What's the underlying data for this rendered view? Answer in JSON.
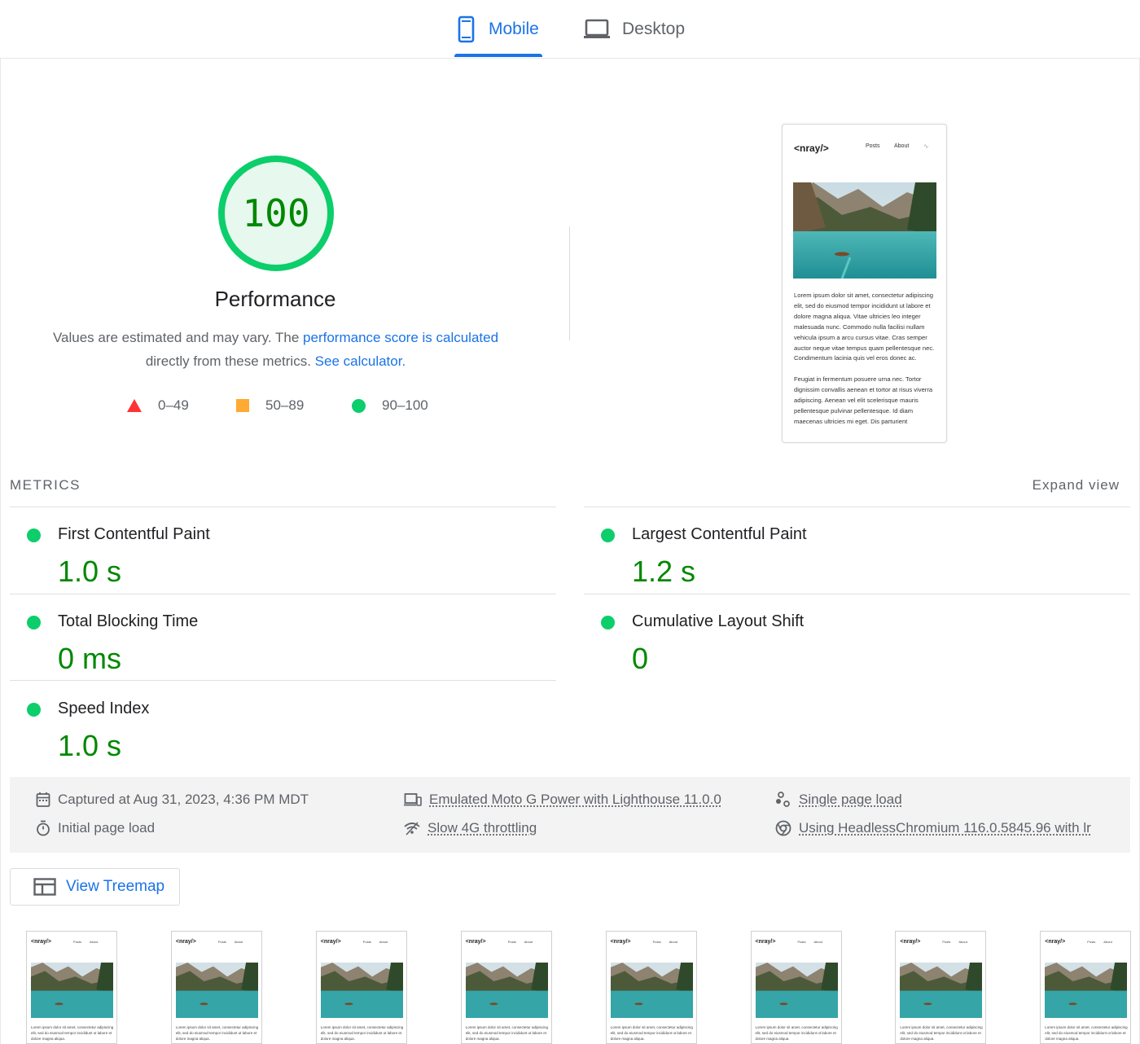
{
  "tabs": {
    "mobile": "Mobile",
    "desktop": "Desktop",
    "active": "Mobile"
  },
  "score": {
    "value": "100",
    "label": "Performance",
    "desc_prefix": "Values are estimated and may vary. The ",
    "desc_link1": "performance score is calculated",
    "desc_middle": " directly from these metrics. ",
    "desc_link2": "See calculator.",
    "color_pass": "#0cce6b",
    "color_text_pass": "#008800"
  },
  "legend": {
    "fail": "0–49",
    "average": "50–89",
    "pass": "90–100",
    "colors": {
      "fail": "#ff3333",
      "average": "#ffaa33",
      "pass": "#0cce6b"
    }
  },
  "screenshot": {
    "logo": "<nray/>",
    "nav_posts": "Posts",
    "nav_about": "About",
    "paragraph1": "Lorem ipsum dolor sit amet, consectetur adipiscing elit, sed do eiusmod tempor incididunt ut labore et dolore magna aliqua. Vitae ultricies leo integer malesuada nunc. Commodo nulla facilisi nullam vehicula ipsum a arcu cursus vitae. Cras semper auctor neque vitae tempus quam pellentesque nec. Condimentum lacinia quis vel eros donec ac.",
    "paragraph2": "Feugiat in fermentum posuere urna nec. Tortor dignissim convallis aenean et tortor at risus viverra adipiscing. Aenean vel elit scelerisque mauris pellentesque pulvinar pellentesque. Id diam maecenas ultricies mi eget. Dis parturient"
  },
  "metrics": {
    "title": "METRICS",
    "expand": "Expand view",
    "fcp": {
      "name": "First Contentful Paint",
      "value": "1.0 s"
    },
    "lcp": {
      "name": "Largest Contentful Paint",
      "value": "1.2 s"
    },
    "tbt": {
      "name": "Total Blocking Time",
      "value": "0 ms"
    },
    "cls": {
      "name": "Cumulative Layout Shift",
      "value": "0"
    },
    "si": {
      "name": "Speed Index",
      "value": "1.0 s"
    }
  },
  "runtime": {
    "captured": "Captured at Aug 31, 2023, 4:36 PM MDT",
    "initial": "Initial page load",
    "device": "Emulated Moto G Power with Lighthouse 11.0.0",
    "throttling": "Slow 4G throttling",
    "single": "Single page load",
    "browser": "Using HeadlessChromium 116.0.5845.96 with lr"
  },
  "treemap": {
    "label": "View Treemap"
  },
  "filmstrip": {
    "logo": "<nray/>",
    "nav_posts": "Posts",
    "nav_about": "About",
    "text": "Lorem ipsum dolor sit amet, consectetur adipiscing elit, sed do eiusmod tempor incididunt ut labore et dolore magna aliqua.",
    "frames": 8
  }
}
